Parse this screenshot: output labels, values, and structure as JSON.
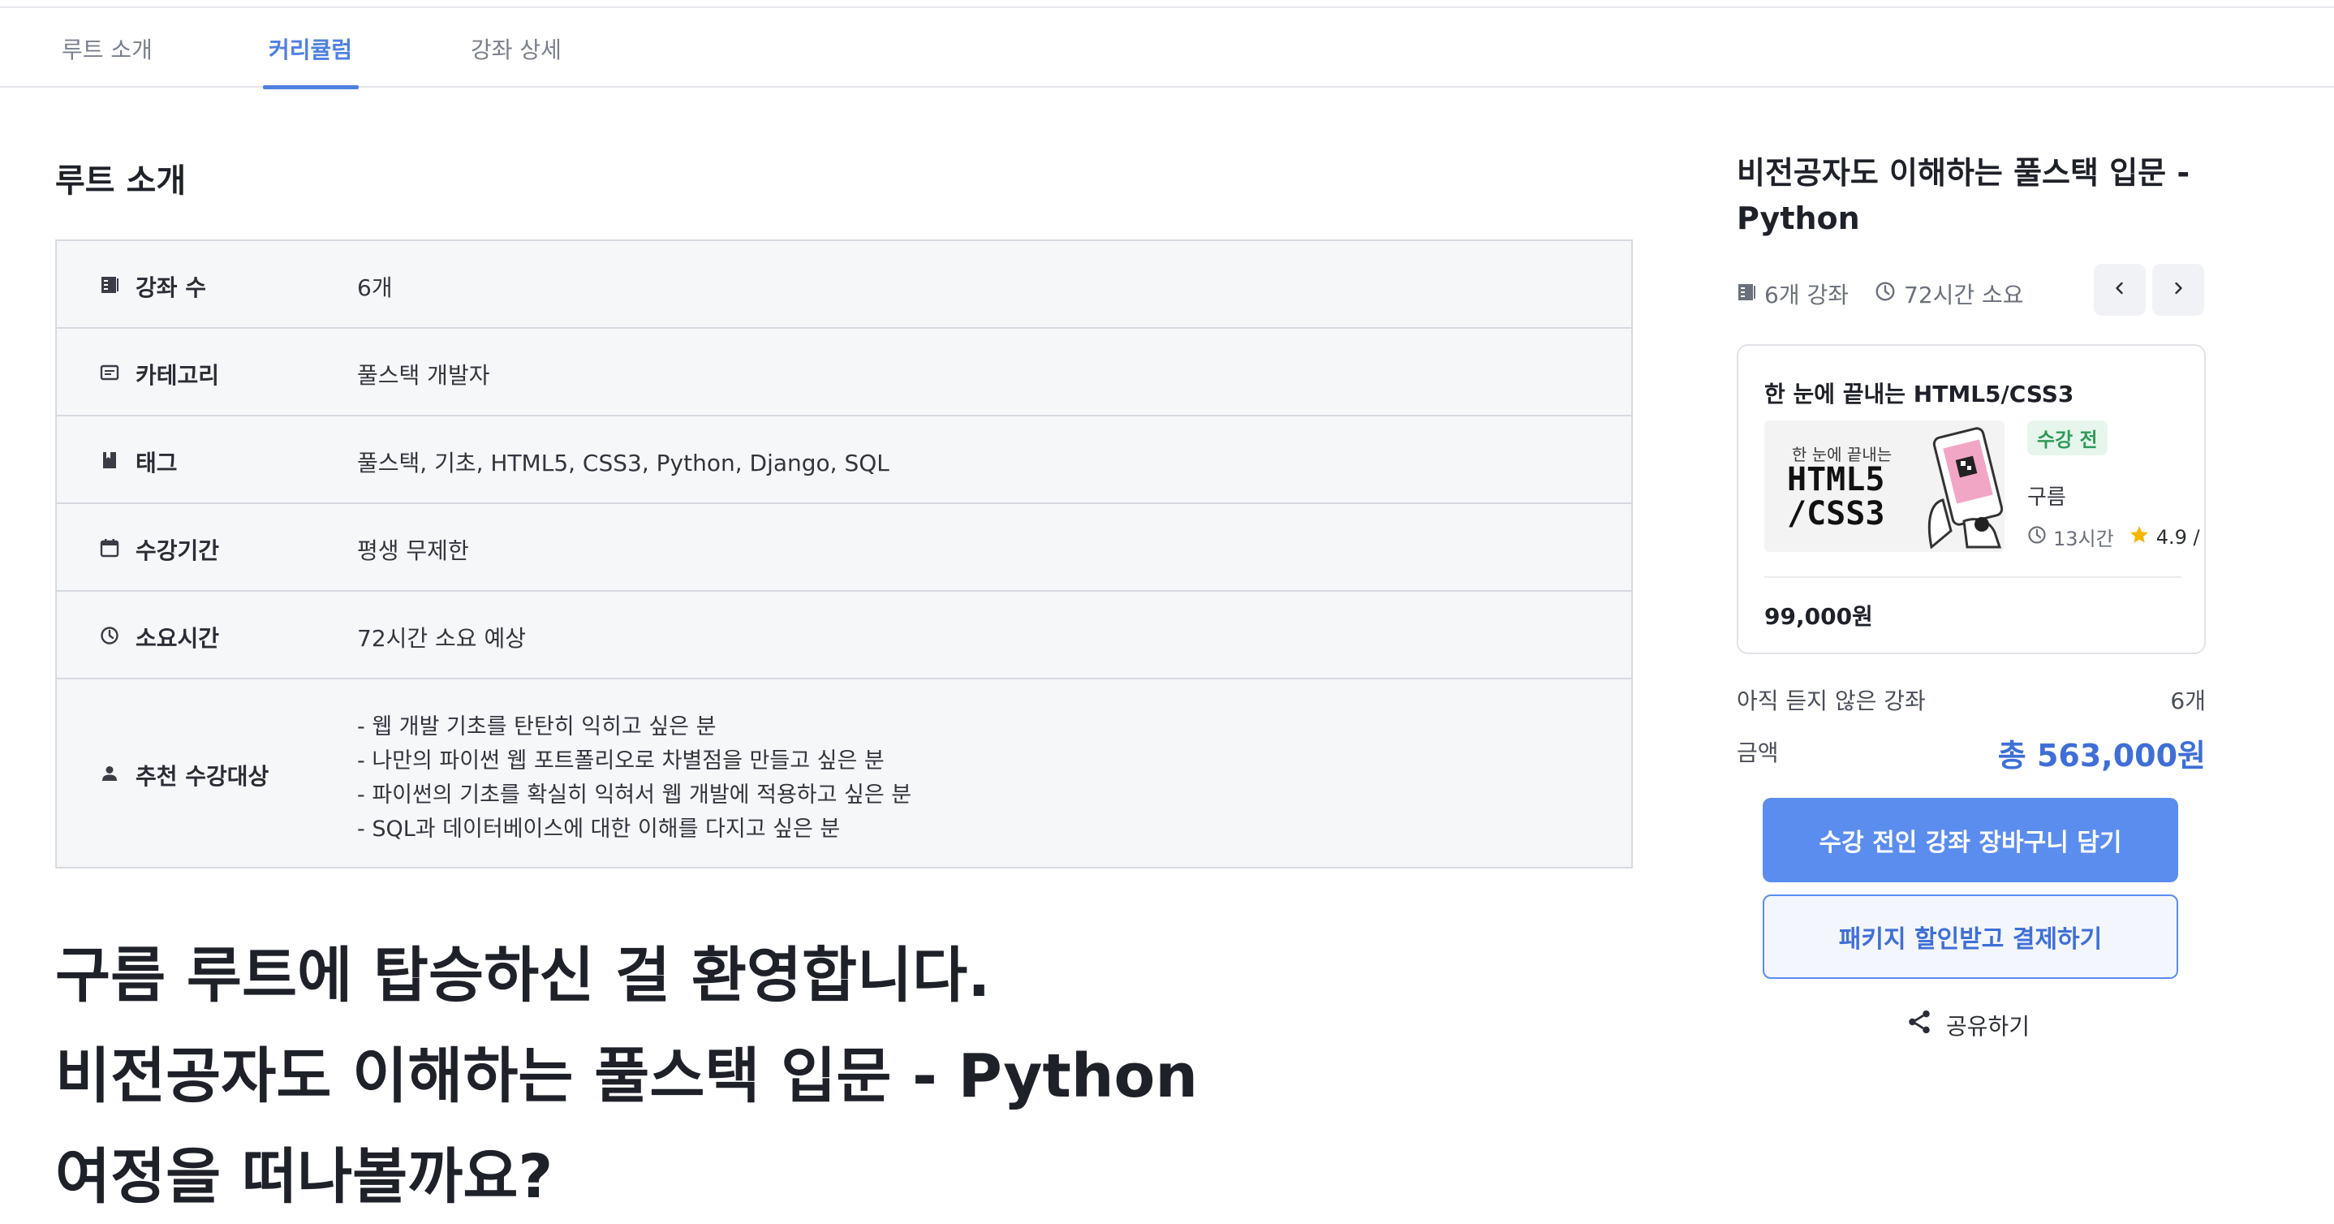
{
  "tabs": [
    {
      "label": "루트 소개"
    },
    {
      "label": "커리큘럼"
    },
    {
      "label": "강좌 상세"
    }
  ],
  "active_tab": "커리큘럼",
  "intro": {
    "title": "루트 소개",
    "rows": [
      {
        "label": "강좌 수",
        "value": "6개",
        "icon": "list-icon"
      },
      {
        "label": "카테고리",
        "value": "풀스택 개발자",
        "icon": "category-icon"
      },
      {
        "label": "태그",
        "value": "풀스택, 기초, HTML5, CSS3, Python, Django, SQL",
        "icon": "bookmark-icon"
      },
      {
        "label": "수강기간",
        "value": "평생 무제한",
        "icon": "calendar-icon"
      },
      {
        "label": "소요시간",
        "value": "72시간 소요 예상",
        "icon": "clock-icon"
      },
      {
        "label": "추천 수강대상",
        "icon": "person-icon",
        "lines": [
          "- 웹 개발 기초를 탄탄히 익히고 싶은 분",
          "- 나만의 파이썬 웹 포트폴리오로 차별점을 만들고 싶은 분",
          "- 파이썬의 기초를 확실히 익혀서 웹 개발에 적용하고 싶은 분",
          "- SQL과 데이터베이스에 대한 이해를 다지고 싶은 분"
        ]
      }
    ]
  },
  "welcome": {
    "lines": [
      "구름 루트에 탑승하신 걸 환영합니다.",
      "비전공자도 이해하는 풀스택 입문 - Python",
      "여정을 떠나볼까요?"
    ]
  },
  "aside": {
    "title_line1": "비전공자도 이해하는 풀스택 입문 -",
    "title_line2": "Python",
    "course_count": "6개 강좌",
    "duration": "72시간 소요",
    "card": {
      "title": "한 눈에 끝내는 HTML5/CSS3",
      "thumb_small": "한 눈에 끝내는",
      "thumb_big_1": "HTML5",
      "thumb_big_2": "/CSS3",
      "status": "수강 전",
      "provider": "구름",
      "hours": "13시간",
      "rating": "4.9 /",
      "price": "99,000원"
    },
    "unwatched_label": "아직 듣지 않은 강좌",
    "unwatched_count": "6개",
    "amount_label": "금액",
    "total": "총 563,000원",
    "cart_button": "수강 전인 강좌 장바구니 담기",
    "pay_button": "패키지 할인받고 결제하기",
    "share": "공유하기"
  },
  "colors": {
    "accent": "#4f80e1",
    "primary_button": "#5b8def",
    "total_text": "#3f6fd6",
    "status_badge_bg": "#e6f6ec",
    "status_badge_text": "#2f9a58",
    "star": "#f5b700"
  }
}
